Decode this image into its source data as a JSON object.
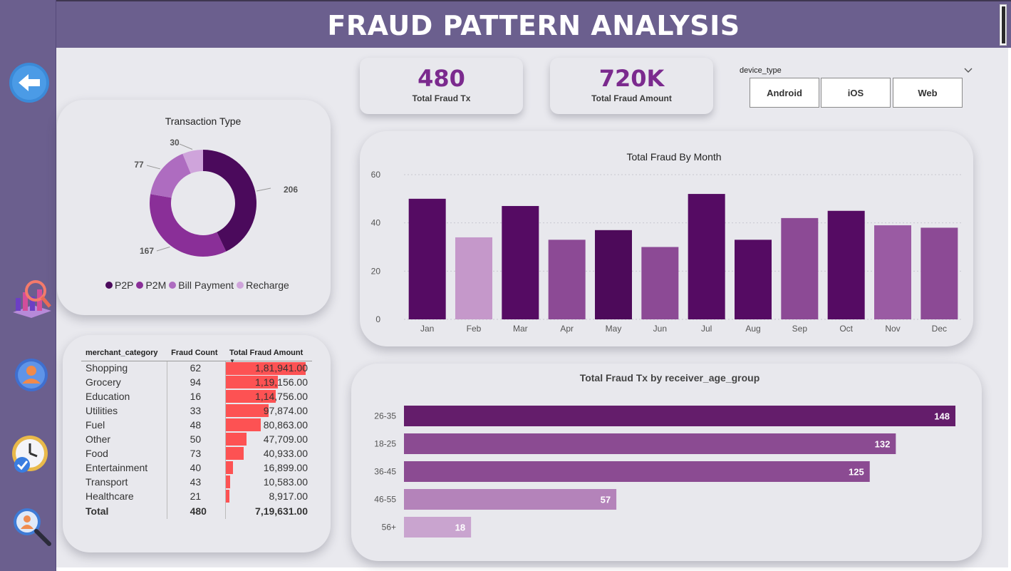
{
  "header": {
    "title": "FRAUD PATTERN ANALYSIS"
  },
  "sidebar": {
    "items": [
      {
        "name": "back-arrow-icon"
      },
      {
        "name": "analytics-chart-icon"
      },
      {
        "name": "user-profile-icon"
      },
      {
        "name": "clock-check-icon"
      },
      {
        "name": "search-user-icon"
      }
    ]
  },
  "kpis": [
    {
      "value": "480",
      "label": "Total Fraud Tx"
    },
    {
      "value": "720K",
      "label": "Total Fraud Amount"
    }
  ],
  "slicer": {
    "title": "device_type",
    "options": [
      "Android",
      "iOS",
      "Web"
    ]
  },
  "transaction_type": {
    "title": "Transaction Type",
    "legend": [
      "P2P",
      "P2M",
      "Bill Payment",
      "Recharge"
    ],
    "colors": [
      "#4b0a5c",
      "#8a2f98",
      "#ae6cc0",
      "#cfa4db"
    ],
    "values": [
      206,
      167,
      77,
      30
    ],
    "labels": [
      "206",
      "167",
      "77",
      "30"
    ]
  },
  "merchant_table": {
    "headers": [
      "merchant_category",
      "Fraud Count",
      "Total Fraud Amount"
    ],
    "rows": [
      {
        "category": "Shopping",
        "count": "62",
        "amount": "1,81,941.00",
        "amount_value": 181941
      },
      {
        "category": "Grocery",
        "count": "94",
        "amount": "1,19,156.00",
        "amount_value": 119156
      },
      {
        "category": "Education",
        "count": "16",
        "amount": "1,14,756.00",
        "amount_value": 114756
      },
      {
        "category": "Utilities",
        "count": "33",
        "amount": "97,874.00",
        "amount_value": 97874
      },
      {
        "category": "Fuel",
        "count": "48",
        "amount": "80,863.00",
        "amount_value": 80863
      },
      {
        "category": "Other",
        "count": "50",
        "amount": "47,709.00",
        "amount_value": 47709
      },
      {
        "category": "Food",
        "count": "73",
        "amount": "40,933.00",
        "amount_value": 40933
      },
      {
        "category": "Entertainment",
        "count": "40",
        "amount": "16,899.00",
        "amount_value": 16899
      },
      {
        "category": "Transport",
        "count": "43",
        "amount": "10,583.00",
        "amount_value": 10583
      },
      {
        "category": "Healthcare",
        "count": "21",
        "amount": "8,917.00",
        "amount_value": 8917
      }
    ],
    "total": {
      "label": "Total",
      "count": "480",
      "amount": "7,19,631.00"
    },
    "bar_color": "#fd5253"
  },
  "chart_data": [
    {
      "type": "bar",
      "title": "Total Fraud By Month",
      "categories": [
        "Jan",
        "Feb",
        "Mar",
        "Apr",
        "May",
        "Jun",
        "Jul",
        "Aug",
        "Sep",
        "Oct",
        "Nov",
        "Dec"
      ],
      "values": [
        50,
        34,
        47,
        33,
        37,
        30,
        52,
        33,
        42,
        45,
        39,
        38
      ],
      "colors": [
        "#550b63",
        "#c598ca",
        "#550b63",
        "#8c4a95",
        "#4d0a5a",
        "#8c4a95",
        "#550b63",
        "#550b63",
        "#8c4a95",
        "#550b63",
        "#9a5ba3",
        "#8c4a95"
      ],
      "ylim": [
        0,
        60
      ],
      "yticks": [
        0,
        20,
        40,
        60
      ],
      "grid": true
    },
    {
      "type": "bar",
      "orientation": "horizontal",
      "title": "Total Fraud Tx by receiver_age_group",
      "categories": [
        "26-35",
        "18-25",
        "36-45",
        "46-55",
        "56+"
      ],
      "values": [
        148,
        132,
        125,
        57,
        18
      ],
      "colors": [
        "#641d6b",
        "#8b4b92",
        "#8b4b92",
        "#b483ba",
        "#c9a4cf"
      ]
    }
  ]
}
